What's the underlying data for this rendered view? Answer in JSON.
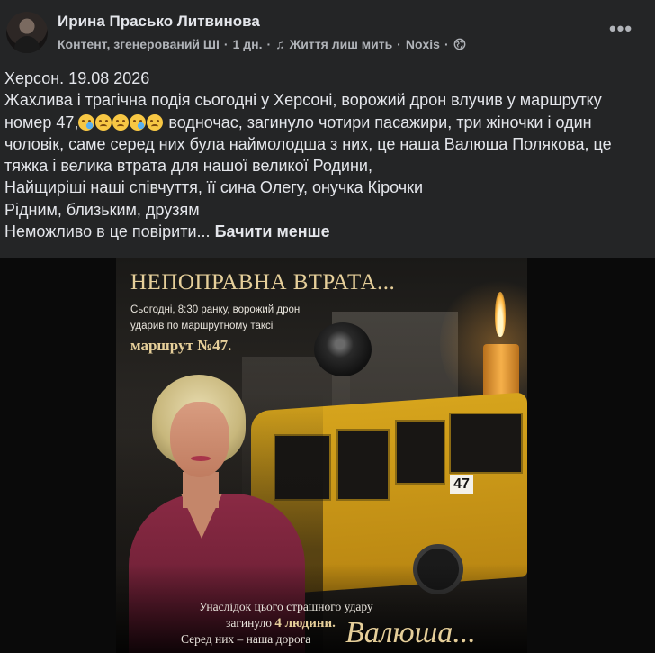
{
  "post": {
    "author": "Ирина Прасько Литвинова",
    "meta": {
      "ai_label": "Контент, згенерований ШІ",
      "time": "1 дн.",
      "music_icon": "music-note-icon",
      "song": "Життя лиш мить",
      "artist": "Noxis",
      "privacy_icon": "globe-icon"
    },
    "more_icon": "more-options-icon",
    "text_lines": [
      "Херсон. 19.08 2026",
      "Жахлива  і трагічна подія сьогодні у Херсоні, ворожий дрон влучив у маршрутку",
      "номер 47,",
      " водночас, загинуло чотири пасажири, три жіночки і один",
      "чоловік, саме серед них була наймолодша з них, це наша Валюша Полякова, це",
      "тяжка і велика втрата для нашої великої Родини,",
      "Найщиріші наші співчуття, її сина Олегу, онучка Кірочки",
      "Рідним, близьким, друзям",
      "Неможливо в це повірити..."
    ],
    "emojis": [
      "crying-face-emoji",
      "sad-face-emoji",
      "disappointed-face-emoji",
      "loudly-crying-face-emoji",
      "downcast-face-emoji"
    ],
    "see_less": "Бачити менше"
  },
  "image": {
    "title": "НЕПОПРАВНА ВТРАТА...",
    "subtitle_line1": "Сьогодні, 8:30 ранку, ворожий дрон",
    "subtitle_line2": "ударив по маршрутному таксі",
    "route": "маршрут №47.",
    "bus_number": "47",
    "caption_line1": "Унаслідок цього страшного удару",
    "caption_line2_prefix": "загинуло",
    "caption_line2_bold": "4 людини.",
    "caption_line3": "Серед них – наша дорога",
    "signature": "Валюша..."
  }
}
